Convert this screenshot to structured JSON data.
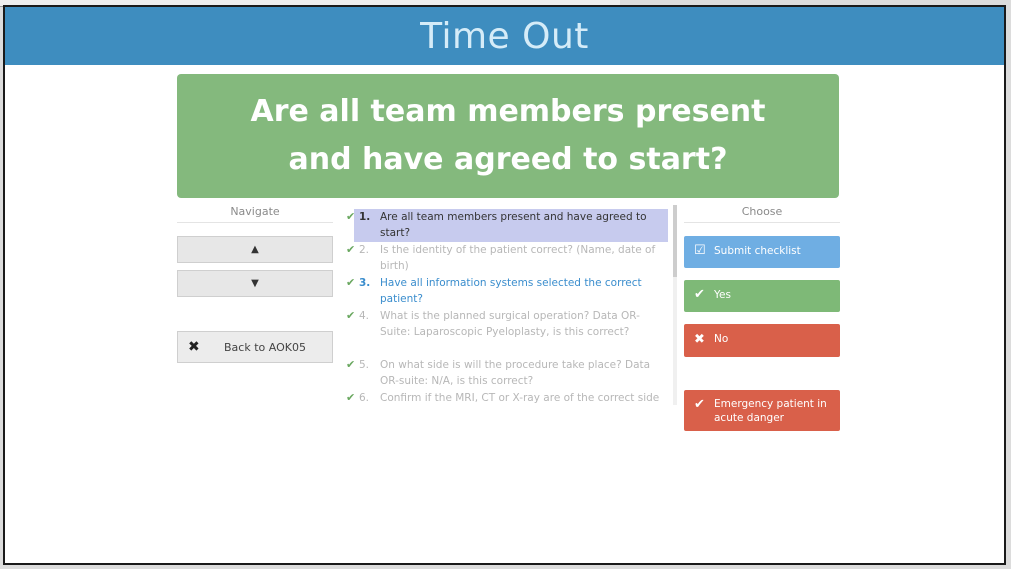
{
  "window": {
    "title": "Time Out"
  },
  "question": {
    "text": "Are all team members present and have agreed to start?"
  },
  "navigate": {
    "header": "Navigate",
    "up_label": "▲",
    "down_label": "▼",
    "back_label": "Back to AOK05"
  },
  "checklist": {
    "items": [
      {
        "number": "1.",
        "text": "Are all team members present and have agreed to start?"
      },
      {
        "number": "2.",
        "text": "Is the identity of the patient correct? (Name, date of birth)"
      },
      {
        "number": "3.",
        "text": "Have all information systems selected the correct patient?"
      },
      {
        "number": "4.",
        "text": "What is the planned surgical operation? Data OR-Suite: Laparoscopic Pyeloplasty, is this correct?"
      },
      {
        "number": "5.",
        "text": "On what side is will the procedure take place? Data OR-suite: N/A, is this correct?"
      },
      {
        "number": "6.",
        "text": "Confirm if the MRI, CT or X-ray are of the correct side"
      }
    ]
  },
  "choose": {
    "header": "Choose",
    "submit_label": "Submit checklist",
    "yes_label": "Yes",
    "no_label": "No",
    "emergency_label": "Emergency patient in acute danger"
  },
  "colors": {
    "titlebar": "#3e8dbf",
    "banner": "#84b97d",
    "submit": "#6faee3",
    "yes": "#7eb977",
    "no": "#d9604a",
    "active_item": "#c7cbee",
    "link_blue": "#3a8dcd"
  },
  "icons": {
    "item_status": "check-icon",
    "submit": "checkbox-icon",
    "yes": "check-icon",
    "no": "close-icon",
    "emergency": "check-icon",
    "back": "close-icon"
  }
}
